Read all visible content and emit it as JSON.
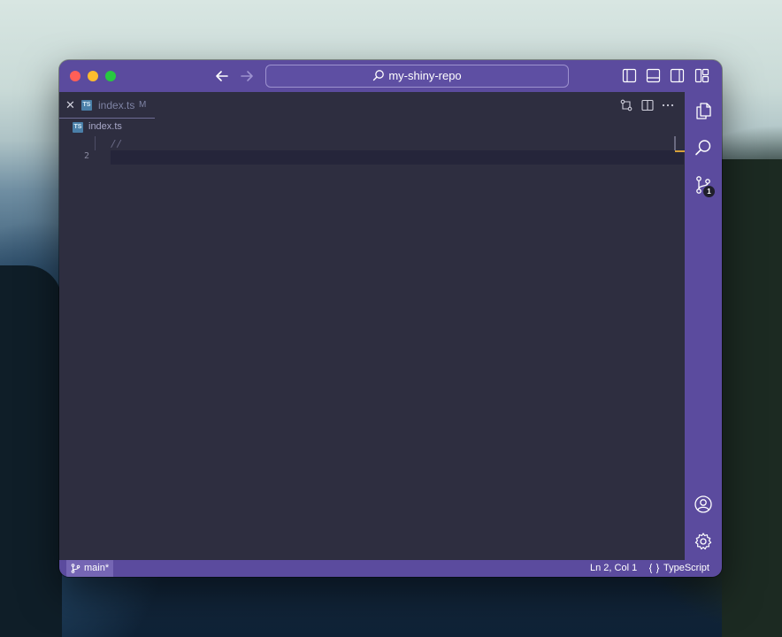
{
  "titlebar": {
    "search_label": "my-shiny-repo",
    "back_icon": "arrow-left-icon",
    "forward_icon": "arrow-right-icon",
    "layout_icons": [
      "toggle-primary-sidebar-icon",
      "toggle-panel-icon",
      "toggle-secondary-sidebar-icon",
      "customize-layout-icon"
    ]
  },
  "tab": {
    "label": "index.ts",
    "modified_marker": "M",
    "file_icon_text": "TS"
  },
  "breadcrumb": {
    "file_icon_text": "TS",
    "label": "index.ts"
  },
  "editor": {
    "line_numbers": [
      "2"
    ],
    "code_line_1": "//",
    "code_line_2": ""
  },
  "activity_bar": {
    "source_control_badge": "1"
  },
  "statusbar": {
    "branch": "main*",
    "cursor_position": "Ln 2, Col 1",
    "language": "TypeScript"
  },
  "colors": {
    "accent": "#5b4b9e",
    "editor_background": "#2e2e40",
    "traffic_red": "#ff5f57",
    "traffic_yellow": "#febc2e",
    "traffic_green": "#28c840"
  }
}
